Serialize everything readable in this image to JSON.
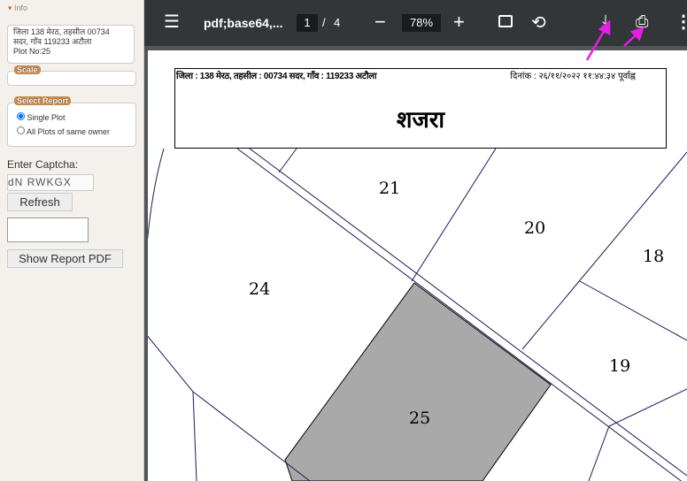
{
  "sidebar": {
    "info_label": "Info",
    "info_text": [
      "जिला  138 मेरठ, तहसील  00734",
      "सदर, गाँव  119233 अटौला",
      "Plot No:25"
    ],
    "scale_legend": "Scale",
    "select_report_legend": "Select Report",
    "options": [
      {
        "label": "Single Plot",
        "checked": true
      },
      {
        "label": "All Plots of same owner",
        "checked": false
      }
    ],
    "captcha_label": "Enter Captcha:",
    "captcha_text": "dN RWKGX",
    "refresh_label": "Refresh",
    "captcha_input": "",
    "show_pdf_label": "Show Report PDF"
  },
  "viewer": {
    "title": "pdf;base64,...",
    "page_current": "1",
    "page_sep": "/",
    "page_total": "4",
    "zoom": "78%"
  },
  "document": {
    "header_left": "जिला : 138 मेरठ, तहसील : 00734 सदर, गाँव : 119233 अटौला",
    "header_right": "दिनांक : २६/११/२०२२ ११:४४:३४ पूर्वाह्न",
    "title": "शजरा",
    "plots": [
      "21",
      "20",
      "18",
      "24",
      "19",
      "25"
    ],
    "highlight_color": "#a9a9a9"
  },
  "annotation_color": "#e61ee6"
}
